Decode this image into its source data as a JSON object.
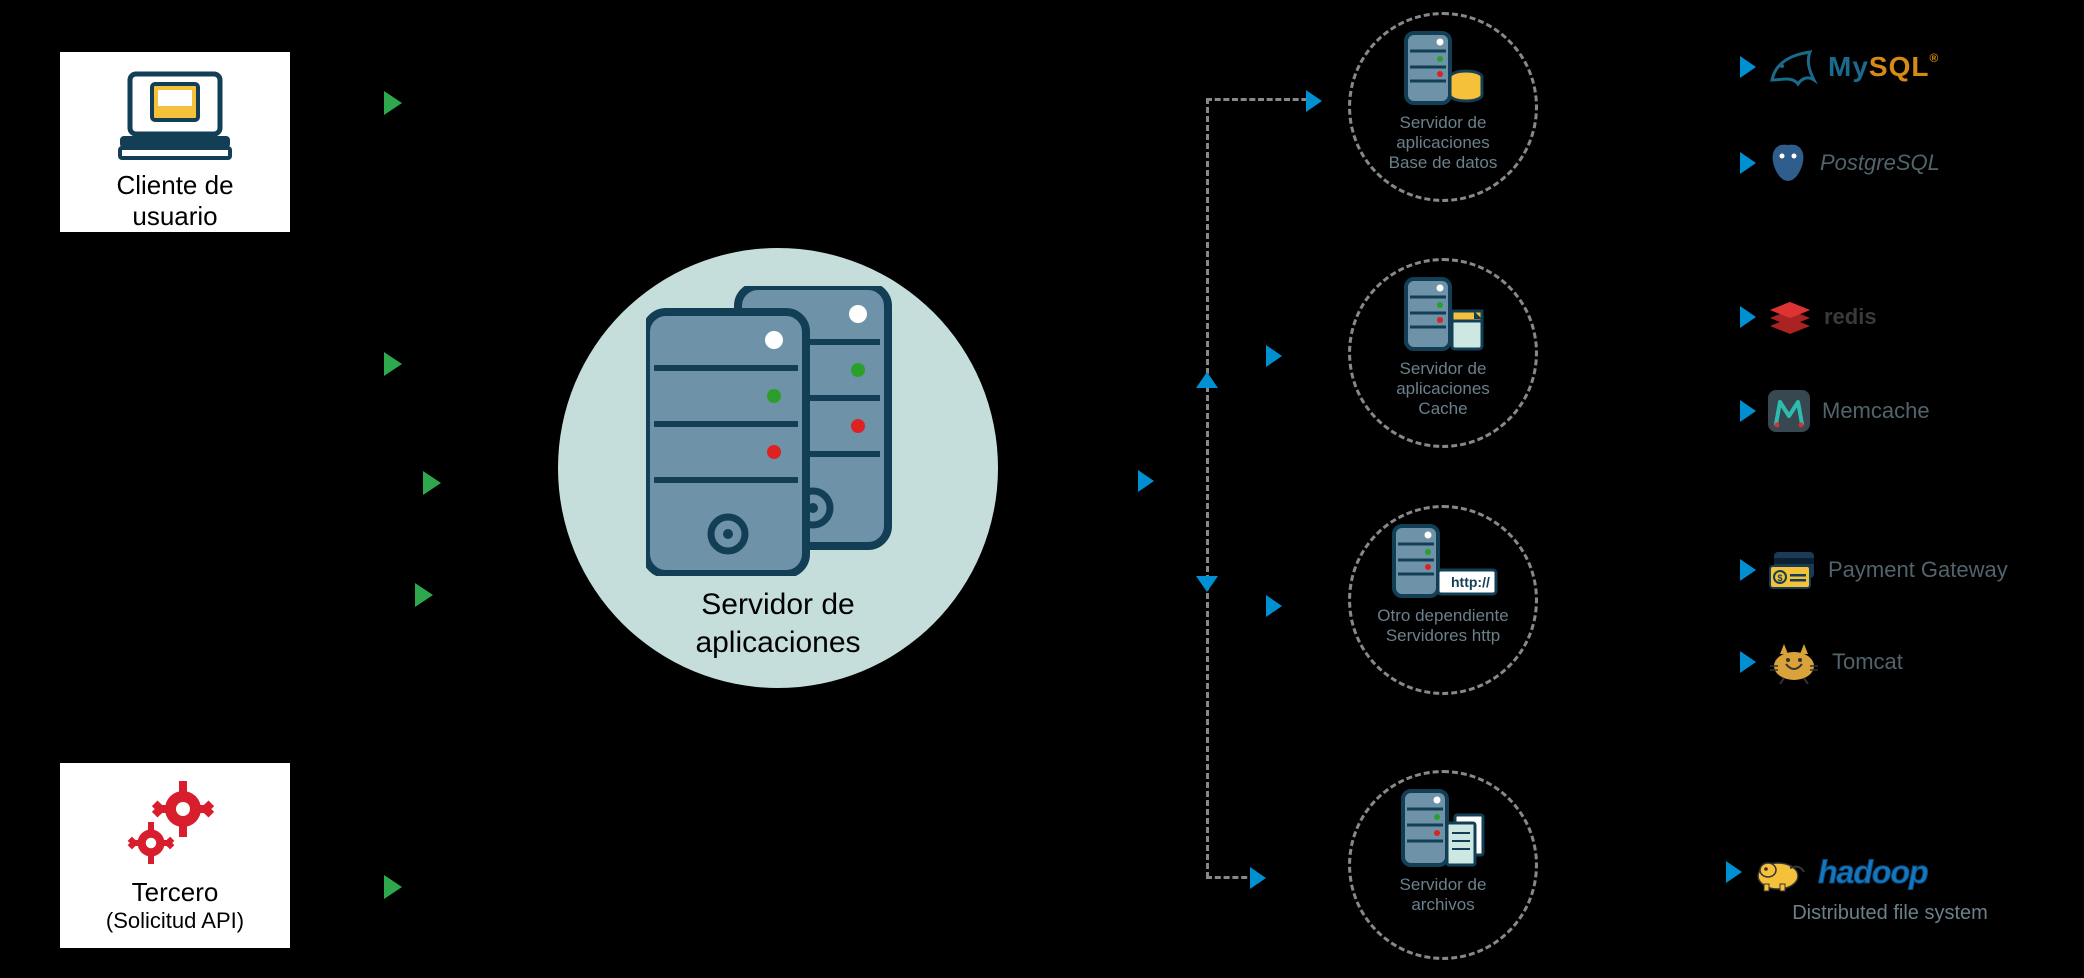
{
  "left": {
    "client": {
      "line1": "Cliente de",
      "line2": "usuario"
    },
    "third": {
      "line1": "Tercero",
      "line2": "(Solicitud API)"
    }
  },
  "center": {
    "line1": "Servidor de",
    "line2": "aplicaciones"
  },
  "circles": {
    "db": {
      "l1": "Servidor de",
      "l2": "aplicaciones",
      "l3": "Base de datos"
    },
    "cache": {
      "l1": "Servidor de",
      "l2": "aplicaciones",
      "l3": "Cache"
    },
    "http": {
      "l1": "Otro dependiente",
      "l2": "Servidores http",
      "badge": "http://"
    },
    "file": {
      "l1": "Servidor de",
      "l2": "archivos"
    }
  },
  "tech": {
    "mysql": "MySQL",
    "postgres": "PostgreSQL",
    "redis": "redis",
    "memcache": "Memcache",
    "payment": "Payment Gateway",
    "tomcat": "Tomcat",
    "hadoop": "hadoop",
    "hadoop_sub": "Distributed file system"
  },
  "colors": {
    "green": "#2da84f",
    "blue": "#0090d2",
    "circle_bg": "#c6dedb",
    "muted": "#6b808a"
  }
}
